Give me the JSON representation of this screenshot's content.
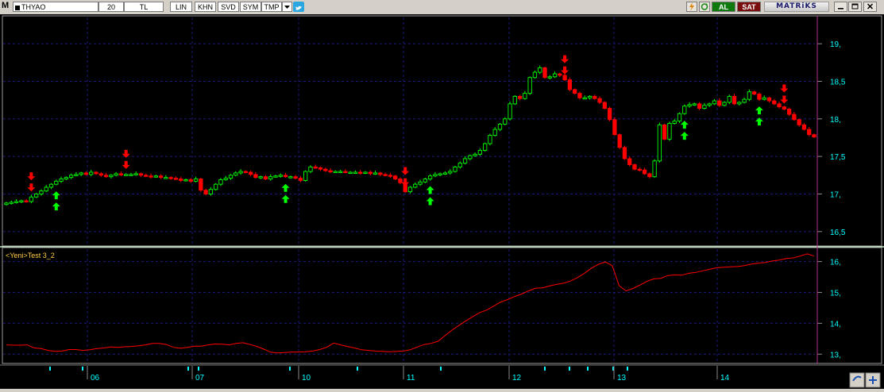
{
  "toolbar": {
    "logo": "M",
    "symbol": "THYAO",
    "period": "20",
    "currency": "TL",
    "scale": "LIN",
    "buttons": [
      "KHN",
      "SVD",
      "SYM",
      "TMP"
    ],
    "buy_label": "AL",
    "sell_label": "SAT",
    "brand": "MATRiKS",
    "icons": [
      "dropdown-icon",
      "twitter-icon",
      "lightning-icon",
      "refresh-icon",
      "minimize-icon",
      "restore-icon",
      "close-icon"
    ]
  },
  "indicator_title": "<Yeni>Test 3_2",
  "colors": {
    "up": "#00ff00",
    "down": "#ff0000",
    "indicator_line": "#ff0000",
    "axis_text": "#00ffff",
    "grid": "#1a1a7a",
    "cursor_line": "#b03090",
    "buy_button": "#0e7a0e",
    "sell_button": "#7a0e0e"
  },
  "chart_data": [
    {
      "type": "candlestick",
      "title": "",
      "ylim": [
        16.35,
        19.35
      ],
      "y_ticks": [
        "19,",
        "18,5",
        "18,",
        "17,5",
        "17,",
        "16,5"
      ],
      "x_ticks": [
        "06",
        "07",
        "10",
        "11",
        "12",
        "13",
        "14"
      ],
      "closes": [
        16.88,
        16.89,
        16.9,
        16.91,
        16.9,
        16.96,
        17.0,
        17.04,
        17.09,
        17.13,
        17.17,
        17.2,
        17.22,
        17.25,
        17.26,
        17.28,
        17.26,
        17.29,
        17.27,
        17.25,
        17.23,
        17.25,
        17.27,
        17.26,
        17.26,
        17.26,
        17.27,
        17.25,
        17.24,
        17.23,
        17.24,
        17.22,
        17.22,
        17.21,
        17.2,
        17.18,
        17.19,
        17.17,
        17.2,
        17.05,
        17.0,
        17.06,
        17.13,
        17.19,
        17.21,
        17.25,
        17.28,
        17.3,
        17.29,
        17.26,
        17.22,
        17.23,
        17.2,
        17.23,
        17.24,
        17.25,
        17.23,
        17.23,
        17.21,
        17.18,
        17.3,
        17.36,
        17.35,
        17.33,
        17.31,
        17.3,
        17.3,
        17.3,
        17.29,
        17.29,
        17.29,
        17.28,
        17.29,
        17.27,
        17.28,
        17.26,
        17.25,
        17.24,
        17.2,
        17.15,
        17.03,
        17.09,
        17.13,
        17.16,
        17.2,
        17.24,
        17.26,
        17.27,
        17.28,
        17.3,
        17.36,
        17.41,
        17.47,
        17.51,
        17.53,
        17.58,
        17.67,
        17.78,
        17.86,
        17.93,
        18.0,
        18.2,
        18.3,
        18.27,
        18.34,
        18.55,
        18.62,
        18.68,
        18.55,
        18.56,
        18.6,
        18.58,
        18.52,
        18.39,
        18.34,
        18.28,
        18.28,
        18.3,
        18.27,
        18.22,
        18.14,
        17.99,
        17.79,
        17.62,
        17.47,
        17.39,
        17.33,
        17.32,
        17.27,
        17.23,
        17.44,
        17.92,
        17.73,
        17.94,
        17.97,
        18.07,
        18.17,
        18.19,
        18.2,
        18.14,
        18.18,
        18.2,
        18.24,
        18.18,
        18.22,
        18.3,
        18.2,
        18.22,
        18.26,
        18.36,
        18.33,
        18.26,
        18.28,
        18.24,
        18.2,
        18.16,
        18.13,
        18.06,
        17.99,
        17.92,
        17.86,
        17.79,
        17.76
      ]
    },
    {
      "type": "line",
      "title": "<Yeni>Test 3_2",
      "ylim": [
        12.75,
        16.3
      ],
      "y_ticks": [
        "16,",
        "15,",
        "14,",
        "13,"
      ],
      "values": [
        13.3,
        13.29,
        13.29,
        13.3,
        13.2,
        13.18,
        13.12,
        13.09,
        13.1,
        13.15,
        13.15,
        13.12,
        13.14,
        13.18,
        13.2,
        13.23,
        13.22,
        13.24,
        13.25,
        13.27,
        13.3,
        13.35,
        13.35,
        13.31,
        13.22,
        13.19,
        13.22,
        13.26,
        13.26,
        13.3,
        13.33,
        13.32,
        13.3,
        13.35,
        13.37,
        13.31,
        13.25,
        13.16,
        13.06,
        13.04,
        13.05,
        13.07,
        13.07,
        13.08,
        13.1,
        13.15,
        13.22,
        13.36,
        13.3,
        13.25,
        13.2,
        13.14,
        13.12,
        13.1,
        13.09,
        13.08,
        13.09,
        13.1,
        13.14,
        13.23,
        13.31,
        13.35,
        13.42,
        13.6,
        13.78,
        13.93,
        14.08,
        14.22,
        14.35,
        14.43,
        14.56,
        14.69,
        14.77,
        14.87,
        14.95,
        15.05,
        15.14,
        15.15,
        15.21,
        15.26,
        15.3,
        15.37,
        15.48,
        15.62,
        15.78,
        15.91,
        15.99,
        15.87,
        15.22,
        15.05,
        15.13,
        15.24,
        15.36,
        15.44,
        15.46,
        15.55,
        15.57,
        15.56,
        15.62,
        15.65,
        15.7,
        15.75,
        15.8,
        15.82,
        15.83,
        15.84,
        15.87,
        15.92,
        15.95,
        15.97,
        16.02,
        16.05,
        16.1,
        16.12,
        16.18,
        16.25,
        16.18
      ]
    }
  ],
  "signals": {
    "sell_at_candle": [
      5,
      24,
      80,
      112,
      156
    ],
    "buy_at_candle": [
      10,
      56,
      85,
      136,
      151
    ]
  }
}
